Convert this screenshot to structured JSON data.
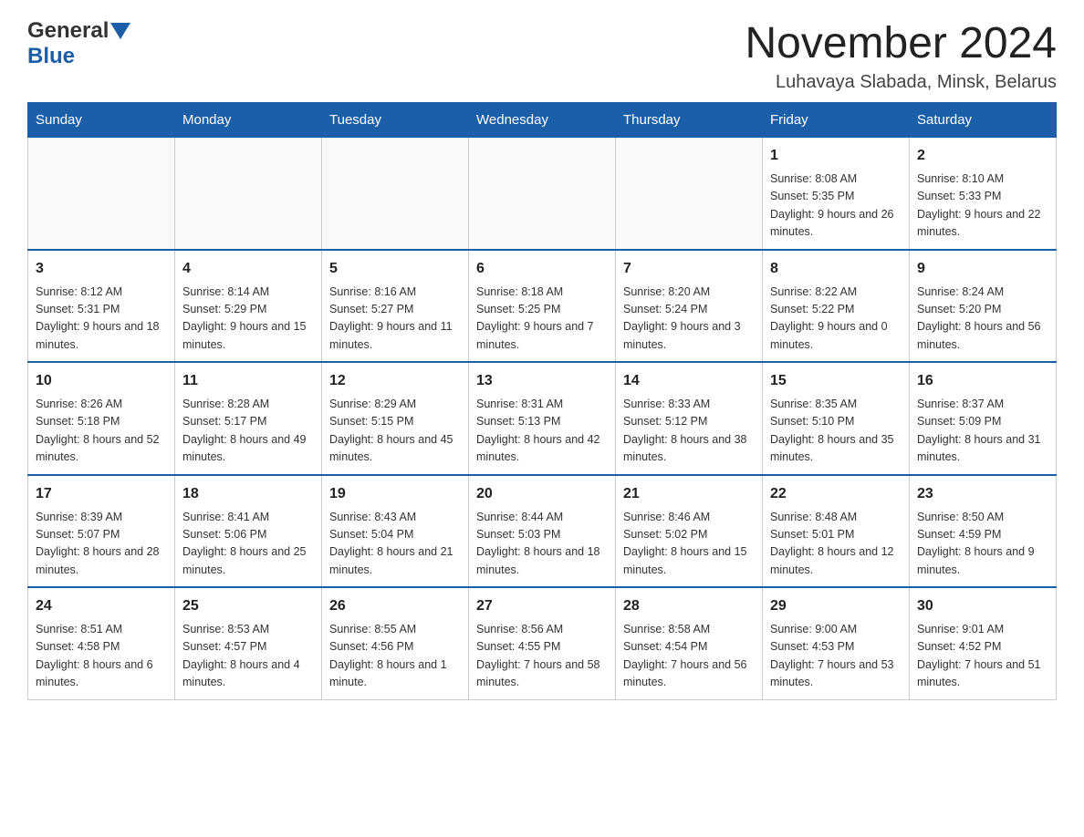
{
  "logo": {
    "general": "General",
    "blue": "Blue"
  },
  "title": "November 2024",
  "subtitle": "Luhavaya Slabada, Minsk, Belarus",
  "headers": [
    "Sunday",
    "Monday",
    "Tuesday",
    "Wednesday",
    "Thursday",
    "Friday",
    "Saturday"
  ],
  "weeks": [
    [
      {
        "day": "",
        "info": ""
      },
      {
        "day": "",
        "info": ""
      },
      {
        "day": "",
        "info": ""
      },
      {
        "day": "",
        "info": ""
      },
      {
        "day": "",
        "info": ""
      },
      {
        "day": "1",
        "info": "Sunrise: 8:08 AM\nSunset: 5:35 PM\nDaylight: 9 hours and 26 minutes."
      },
      {
        "day": "2",
        "info": "Sunrise: 8:10 AM\nSunset: 5:33 PM\nDaylight: 9 hours and 22 minutes."
      }
    ],
    [
      {
        "day": "3",
        "info": "Sunrise: 8:12 AM\nSunset: 5:31 PM\nDaylight: 9 hours and 18 minutes."
      },
      {
        "day": "4",
        "info": "Sunrise: 8:14 AM\nSunset: 5:29 PM\nDaylight: 9 hours and 15 minutes."
      },
      {
        "day": "5",
        "info": "Sunrise: 8:16 AM\nSunset: 5:27 PM\nDaylight: 9 hours and 11 minutes."
      },
      {
        "day": "6",
        "info": "Sunrise: 8:18 AM\nSunset: 5:25 PM\nDaylight: 9 hours and 7 minutes."
      },
      {
        "day": "7",
        "info": "Sunrise: 8:20 AM\nSunset: 5:24 PM\nDaylight: 9 hours and 3 minutes."
      },
      {
        "day": "8",
        "info": "Sunrise: 8:22 AM\nSunset: 5:22 PM\nDaylight: 9 hours and 0 minutes."
      },
      {
        "day": "9",
        "info": "Sunrise: 8:24 AM\nSunset: 5:20 PM\nDaylight: 8 hours and 56 minutes."
      }
    ],
    [
      {
        "day": "10",
        "info": "Sunrise: 8:26 AM\nSunset: 5:18 PM\nDaylight: 8 hours and 52 minutes."
      },
      {
        "day": "11",
        "info": "Sunrise: 8:28 AM\nSunset: 5:17 PM\nDaylight: 8 hours and 49 minutes."
      },
      {
        "day": "12",
        "info": "Sunrise: 8:29 AM\nSunset: 5:15 PM\nDaylight: 8 hours and 45 minutes."
      },
      {
        "day": "13",
        "info": "Sunrise: 8:31 AM\nSunset: 5:13 PM\nDaylight: 8 hours and 42 minutes."
      },
      {
        "day": "14",
        "info": "Sunrise: 8:33 AM\nSunset: 5:12 PM\nDaylight: 8 hours and 38 minutes."
      },
      {
        "day": "15",
        "info": "Sunrise: 8:35 AM\nSunset: 5:10 PM\nDaylight: 8 hours and 35 minutes."
      },
      {
        "day": "16",
        "info": "Sunrise: 8:37 AM\nSunset: 5:09 PM\nDaylight: 8 hours and 31 minutes."
      }
    ],
    [
      {
        "day": "17",
        "info": "Sunrise: 8:39 AM\nSunset: 5:07 PM\nDaylight: 8 hours and 28 minutes."
      },
      {
        "day": "18",
        "info": "Sunrise: 8:41 AM\nSunset: 5:06 PM\nDaylight: 8 hours and 25 minutes."
      },
      {
        "day": "19",
        "info": "Sunrise: 8:43 AM\nSunset: 5:04 PM\nDaylight: 8 hours and 21 minutes."
      },
      {
        "day": "20",
        "info": "Sunrise: 8:44 AM\nSunset: 5:03 PM\nDaylight: 8 hours and 18 minutes."
      },
      {
        "day": "21",
        "info": "Sunrise: 8:46 AM\nSunset: 5:02 PM\nDaylight: 8 hours and 15 minutes."
      },
      {
        "day": "22",
        "info": "Sunrise: 8:48 AM\nSunset: 5:01 PM\nDaylight: 8 hours and 12 minutes."
      },
      {
        "day": "23",
        "info": "Sunrise: 8:50 AM\nSunset: 4:59 PM\nDaylight: 8 hours and 9 minutes."
      }
    ],
    [
      {
        "day": "24",
        "info": "Sunrise: 8:51 AM\nSunset: 4:58 PM\nDaylight: 8 hours and 6 minutes."
      },
      {
        "day": "25",
        "info": "Sunrise: 8:53 AM\nSunset: 4:57 PM\nDaylight: 8 hours and 4 minutes."
      },
      {
        "day": "26",
        "info": "Sunrise: 8:55 AM\nSunset: 4:56 PM\nDaylight: 8 hours and 1 minute."
      },
      {
        "day": "27",
        "info": "Sunrise: 8:56 AM\nSunset: 4:55 PM\nDaylight: 7 hours and 58 minutes."
      },
      {
        "day": "28",
        "info": "Sunrise: 8:58 AM\nSunset: 4:54 PM\nDaylight: 7 hours and 56 minutes."
      },
      {
        "day": "29",
        "info": "Sunrise: 9:00 AM\nSunset: 4:53 PM\nDaylight: 7 hours and 53 minutes."
      },
      {
        "day": "30",
        "info": "Sunrise: 9:01 AM\nSunset: 4:52 PM\nDaylight: 7 hours and 51 minutes."
      }
    ]
  ]
}
